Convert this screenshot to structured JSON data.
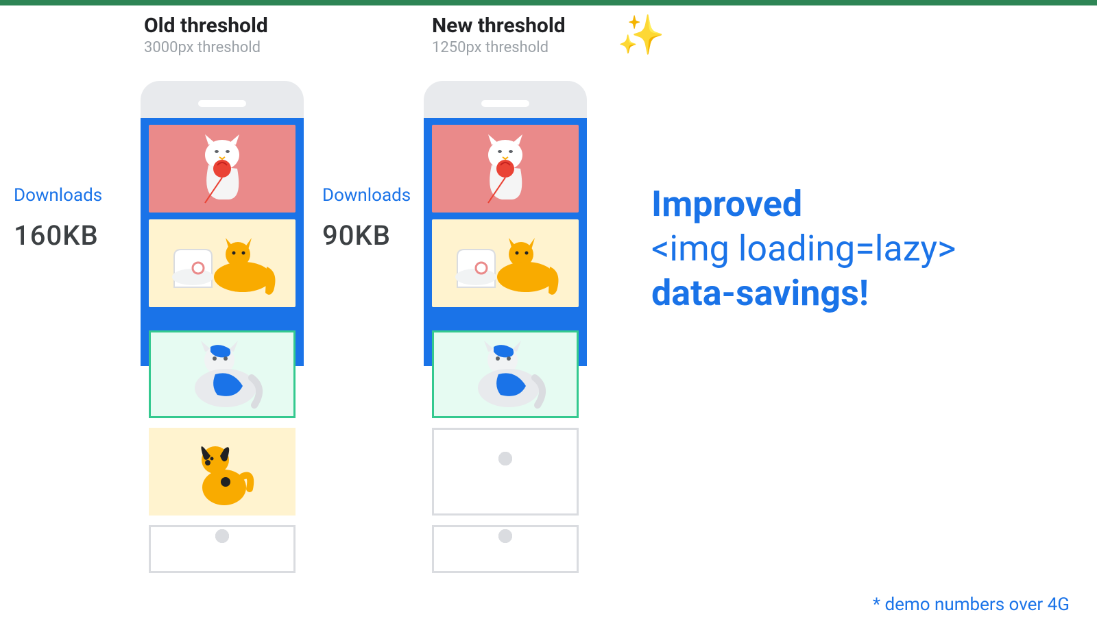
{
  "columns": {
    "old": {
      "title": "Old threshold",
      "subtitle": "3000px threshold",
      "downloads_label": "Downloads",
      "downloads_value": "160KB"
    },
    "new": {
      "title": "New threshold",
      "subtitle": "1250px threshold",
      "downloads_label": "Downloads",
      "downloads_value": "90KB"
    }
  },
  "headline": {
    "line1": "Improved",
    "line2": "<img loading=lazy>",
    "line3": "data-savings!"
  },
  "footnote": "* demo numbers over 4G",
  "phone_tiles": {
    "old": [
      "cat-yarn",
      "orange-cat",
      "blue-cat-loaded",
      "dog-loaded",
      "placeholder"
    ],
    "new": [
      "cat-yarn",
      "orange-cat",
      "blue-cat-loaded",
      "placeholder",
      "placeholder"
    ]
  },
  "icons": {
    "sparkle": "✨"
  },
  "colors": {
    "accent_blue": "#1a73e8",
    "teal_border": "#34c98f",
    "gray_text": "#9aa0a6",
    "dark_text": "#3c4043"
  }
}
